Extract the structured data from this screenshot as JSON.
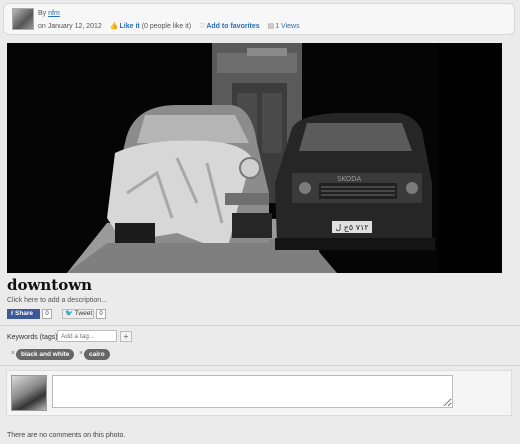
{
  "header": {
    "by_prefix": "By",
    "author": "nfm",
    "date": "on January 12, 2012",
    "like_label": "Like it",
    "like_count": "(0 people like it)",
    "favorites_label": "Add to favorites",
    "views": "1 Views"
  },
  "photo": {
    "title": "downtown",
    "description_placeholder": "Click here to add a description...",
    "plate_text": "٧١٢ ٥ج ل"
  },
  "share": {
    "fb_label": "Share",
    "fb_count": "0",
    "tweet_label": "Tweet",
    "tweet_count": "0"
  },
  "keywords": {
    "label": "Keywords (tags):",
    "input_placeholder": "Add a tag...",
    "add_button": "+",
    "tags": [
      "black and white",
      "cairo"
    ]
  },
  "comments": {
    "empty_text": "There are no comments on this photo."
  },
  "icons": [
    "thumbs-up-icon",
    "heart-icon",
    "views-icon",
    "remove-tag-icon"
  ],
  "colors": {
    "link": "#2a6eb5",
    "facebook": "#3b5998",
    "tag_bg": "#666666"
  }
}
